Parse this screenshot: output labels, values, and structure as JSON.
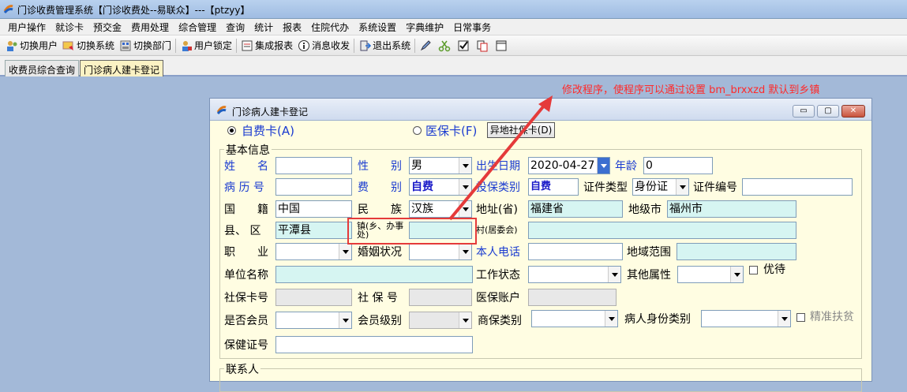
{
  "app": {
    "title": "门诊收费管理系统【门诊收费处--易联众】---【ptzyy】"
  },
  "menu": [
    "用户操作",
    "就诊卡",
    "预交金",
    "费用处理",
    "综合管理",
    "查询",
    "统计",
    "报表",
    "住院代办",
    "系统设置",
    "字典维护",
    "日常事务"
  ],
  "toolbar": {
    "switch_user": "切换用户",
    "switch_system": "切换系统",
    "switch_dept": "切换部门",
    "user_lock": "用户锁定",
    "integrated_report": "集成报表",
    "message": "消息收发",
    "exit": "退出系统"
  },
  "tabs": [
    "收费员综合查询",
    "门诊病人建卡登记"
  ],
  "annotation": "修改程序，使程序可以通过设置 bm_brxxzd 默认到乡镇",
  "window": {
    "title": "门诊病人建卡登记",
    "btn_min": "▭",
    "btn_max": "▢",
    "btn_close": "✕"
  },
  "card_type": {
    "self_pay": "自费卡(A)",
    "medical": "医保卡(F)",
    "remote_btn": "异地社保卡(D)"
  },
  "basic_info_legend": "基本信息",
  "contact_legend": "联系人",
  "labels": {
    "name": "姓　　名",
    "gender": "性　　别",
    "birth": "出生日期",
    "age": "年龄",
    "record_no": "病 历 号",
    "fee_type": "费　　别",
    "insurance_type": "投保类别",
    "id_type": "证件类型",
    "id_no": "证件编号",
    "nationality": "国　　籍",
    "ethnic": "民　　族",
    "province": "地址(省)",
    "city": "地级市",
    "county": "县、 区",
    "town": "镇(乡、办事处)",
    "village": "村(居委会)",
    "job": "职　　业",
    "marriage": "婚姻状况",
    "phone": "本人电话",
    "region": "地域范围",
    "company": "单位名称",
    "work_status": "工作状态",
    "other_attr": "其他属性",
    "priority": "优待",
    "social_card": "社保卡号",
    "social_no": "社 保 号",
    "medical_account": "医保账户",
    "member": "是否会员",
    "member_level": "会员级别",
    "commercial": "商保类别",
    "identity_type": "病人身份类别",
    "poverty": "精准扶贫",
    "health_card": "保健证号"
  },
  "values": {
    "name": "",
    "gender": "男",
    "birth": "2020-04-27",
    "age": "0",
    "fee_type": "自费",
    "insurance_type": "自费",
    "id_type": "身份证",
    "nationality": "中国",
    "ethnic": "汉族",
    "province": "福建省",
    "city": "福州市",
    "county": "平潭县"
  }
}
